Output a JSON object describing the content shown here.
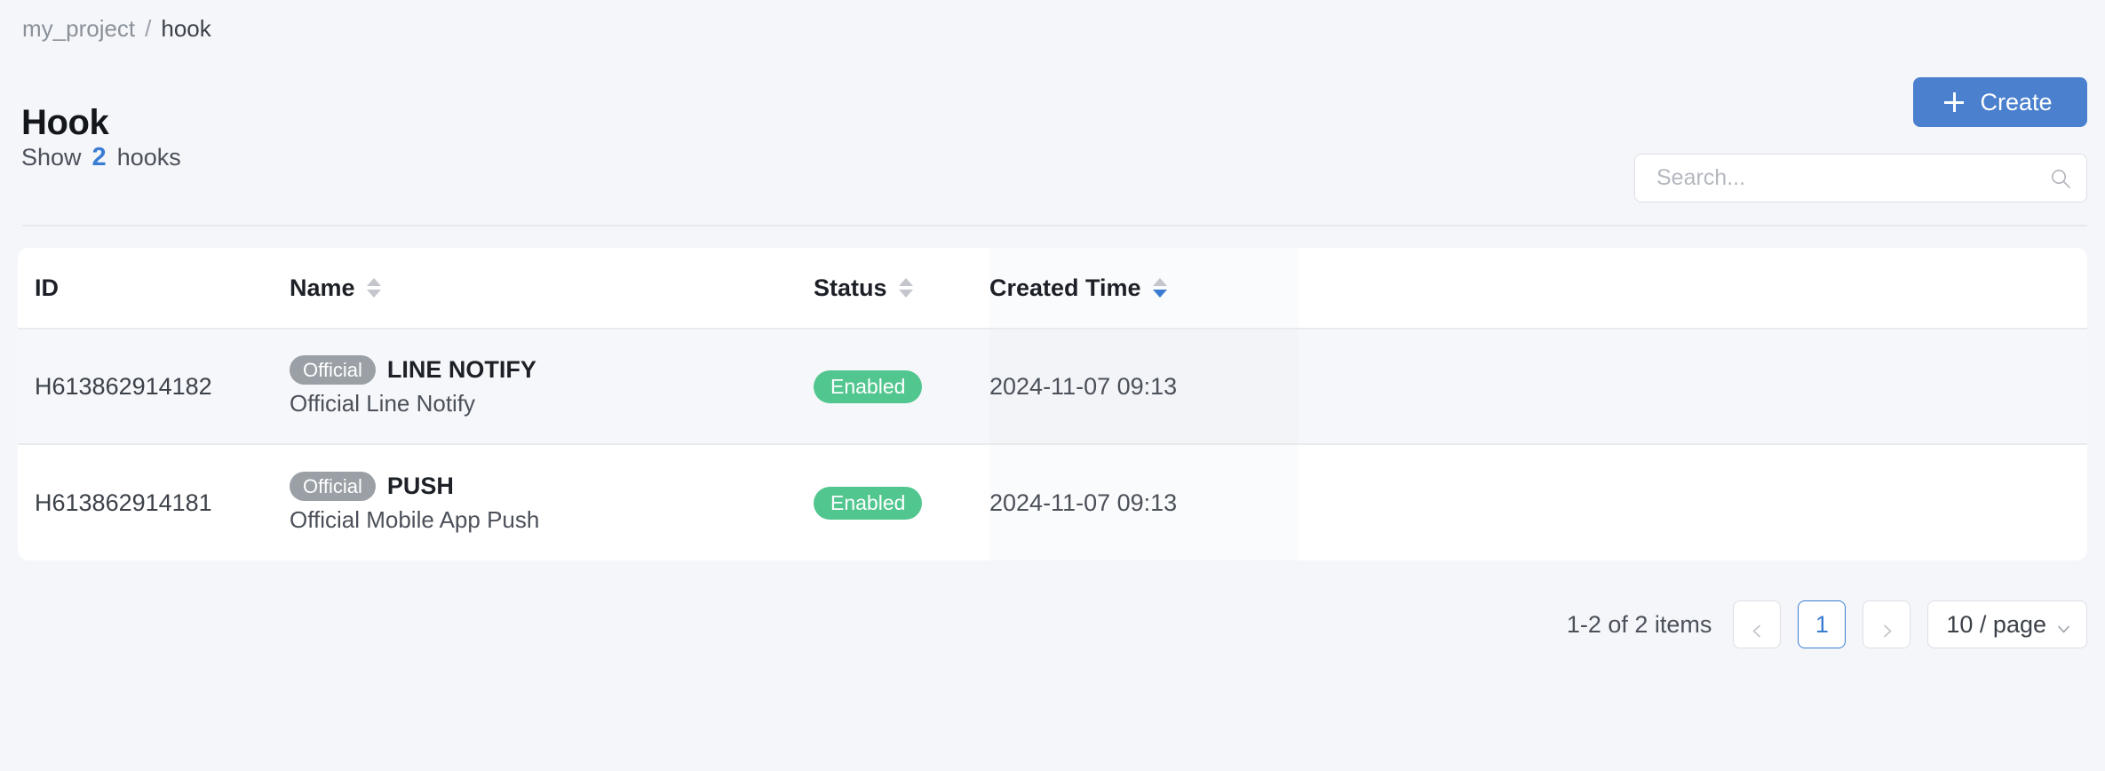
{
  "breadcrumb": {
    "project": "my_project",
    "separator": "/",
    "current": "hook"
  },
  "header": {
    "title": "Hook",
    "create_label": "Create",
    "create_icon": "plus-icon",
    "accent_color": "#4a80ce"
  },
  "toolbar": {
    "show_prefix": "Show",
    "show_count": "2",
    "show_suffix": "hooks",
    "search_placeholder": "Search...",
    "search_value": "",
    "search_icon": "search-icon"
  },
  "table": {
    "columns": [
      {
        "key": "id",
        "label": "ID",
        "sortable": false,
        "sort": "none"
      },
      {
        "key": "name",
        "label": "Name",
        "sortable": true,
        "sort": "none"
      },
      {
        "key": "status",
        "label": "Status",
        "sortable": true,
        "sort": "none"
      },
      {
        "key": "time",
        "label": "Created Time",
        "sortable": true,
        "sort": "desc"
      }
    ],
    "rows": [
      {
        "id": "H613862914182",
        "badge": "Official",
        "name": "LINE NOTIFY",
        "description": "Official Line Notify",
        "status": "Enabled",
        "created_time": "2024-11-07 09:13",
        "hovered": true
      },
      {
        "id": "H613862914181",
        "badge": "Official",
        "name": "PUSH",
        "description": "Official Mobile App Push",
        "status": "Enabled",
        "created_time": "2024-11-07 09:13",
        "hovered": false
      }
    ],
    "status_color": "#52c68f",
    "badge_color": "#9ba0a6"
  },
  "pagination": {
    "total_text": "1-2 of 2 items",
    "prev_icon": "chevron-left-icon",
    "next_icon": "chevron-right-icon",
    "current_page": "1",
    "page_size_label": "10 / page",
    "page_size_icon": "chevron-down-icon"
  }
}
